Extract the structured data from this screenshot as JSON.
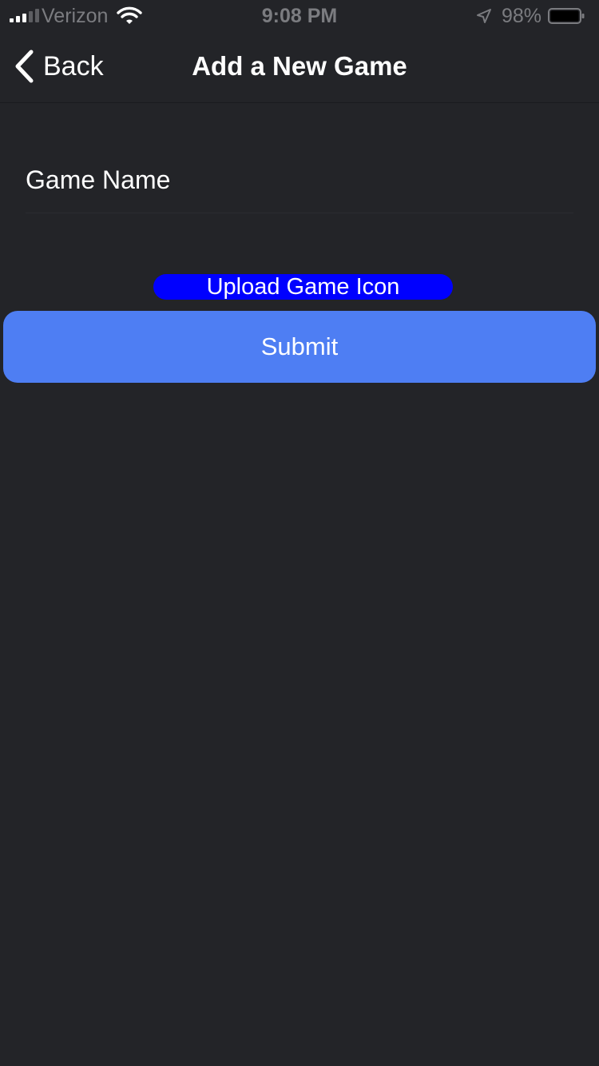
{
  "status_bar": {
    "carrier": "Verizon",
    "time": "9:08 PM",
    "battery_percent": "98%",
    "signal_bars_active": 3,
    "signal_bars_total": 5,
    "icons": [
      "signal-icon",
      "wifi-icon",
      "location-arrow-icon",
      "battery-icon"
    ]
  },
  "nav": {
    "back_label": "Back",
    "title": "Add a New Game"
  },
  "form": {
    "game_name_placeholder": "Game Name",
    "game_name_value": "",
    "upload_label": "Upload Game Icon",
    "submit_label": "Submit"
  },
  "colors": {
    "background": "#232428",
    "upload_button": "#0000ff",
    "submit_button": "#4e7ef3",
    "status_text": "#7b7c80"
  }
}
